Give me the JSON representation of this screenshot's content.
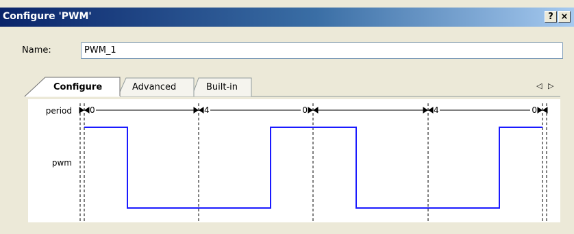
{
  "window": {
    "title": "Configure 'PWM'",
    "help_label": "?",
    "close_label": "×"
  },
  "name": {
    "label": "Name:",
    "value": "PWM_1"
  },
  "tabs": [
    {
      "label": "Configure",
      "active": true
    },
    {
      "label": "Advanced",
      "active": false
    },
    {
      "label": "Built-in",
      "active": false
    }
  ],
  "tab_scroll": {
    "left": "◁",
    "right": "▷"
  },
  "timing": {
    "signals": [
      "period",
      "pwm"
    ],
    "period_labels": [
      "0",
      "4",
      "0",
      "4",
      "0"
    ],
    "pwm_levels": [
      1,
      0,
      1,
      0,
      1
    ],
    "colors": {
      "pwm": "#1a1aff",
      "axis": "#000000"
    }
  }
}
